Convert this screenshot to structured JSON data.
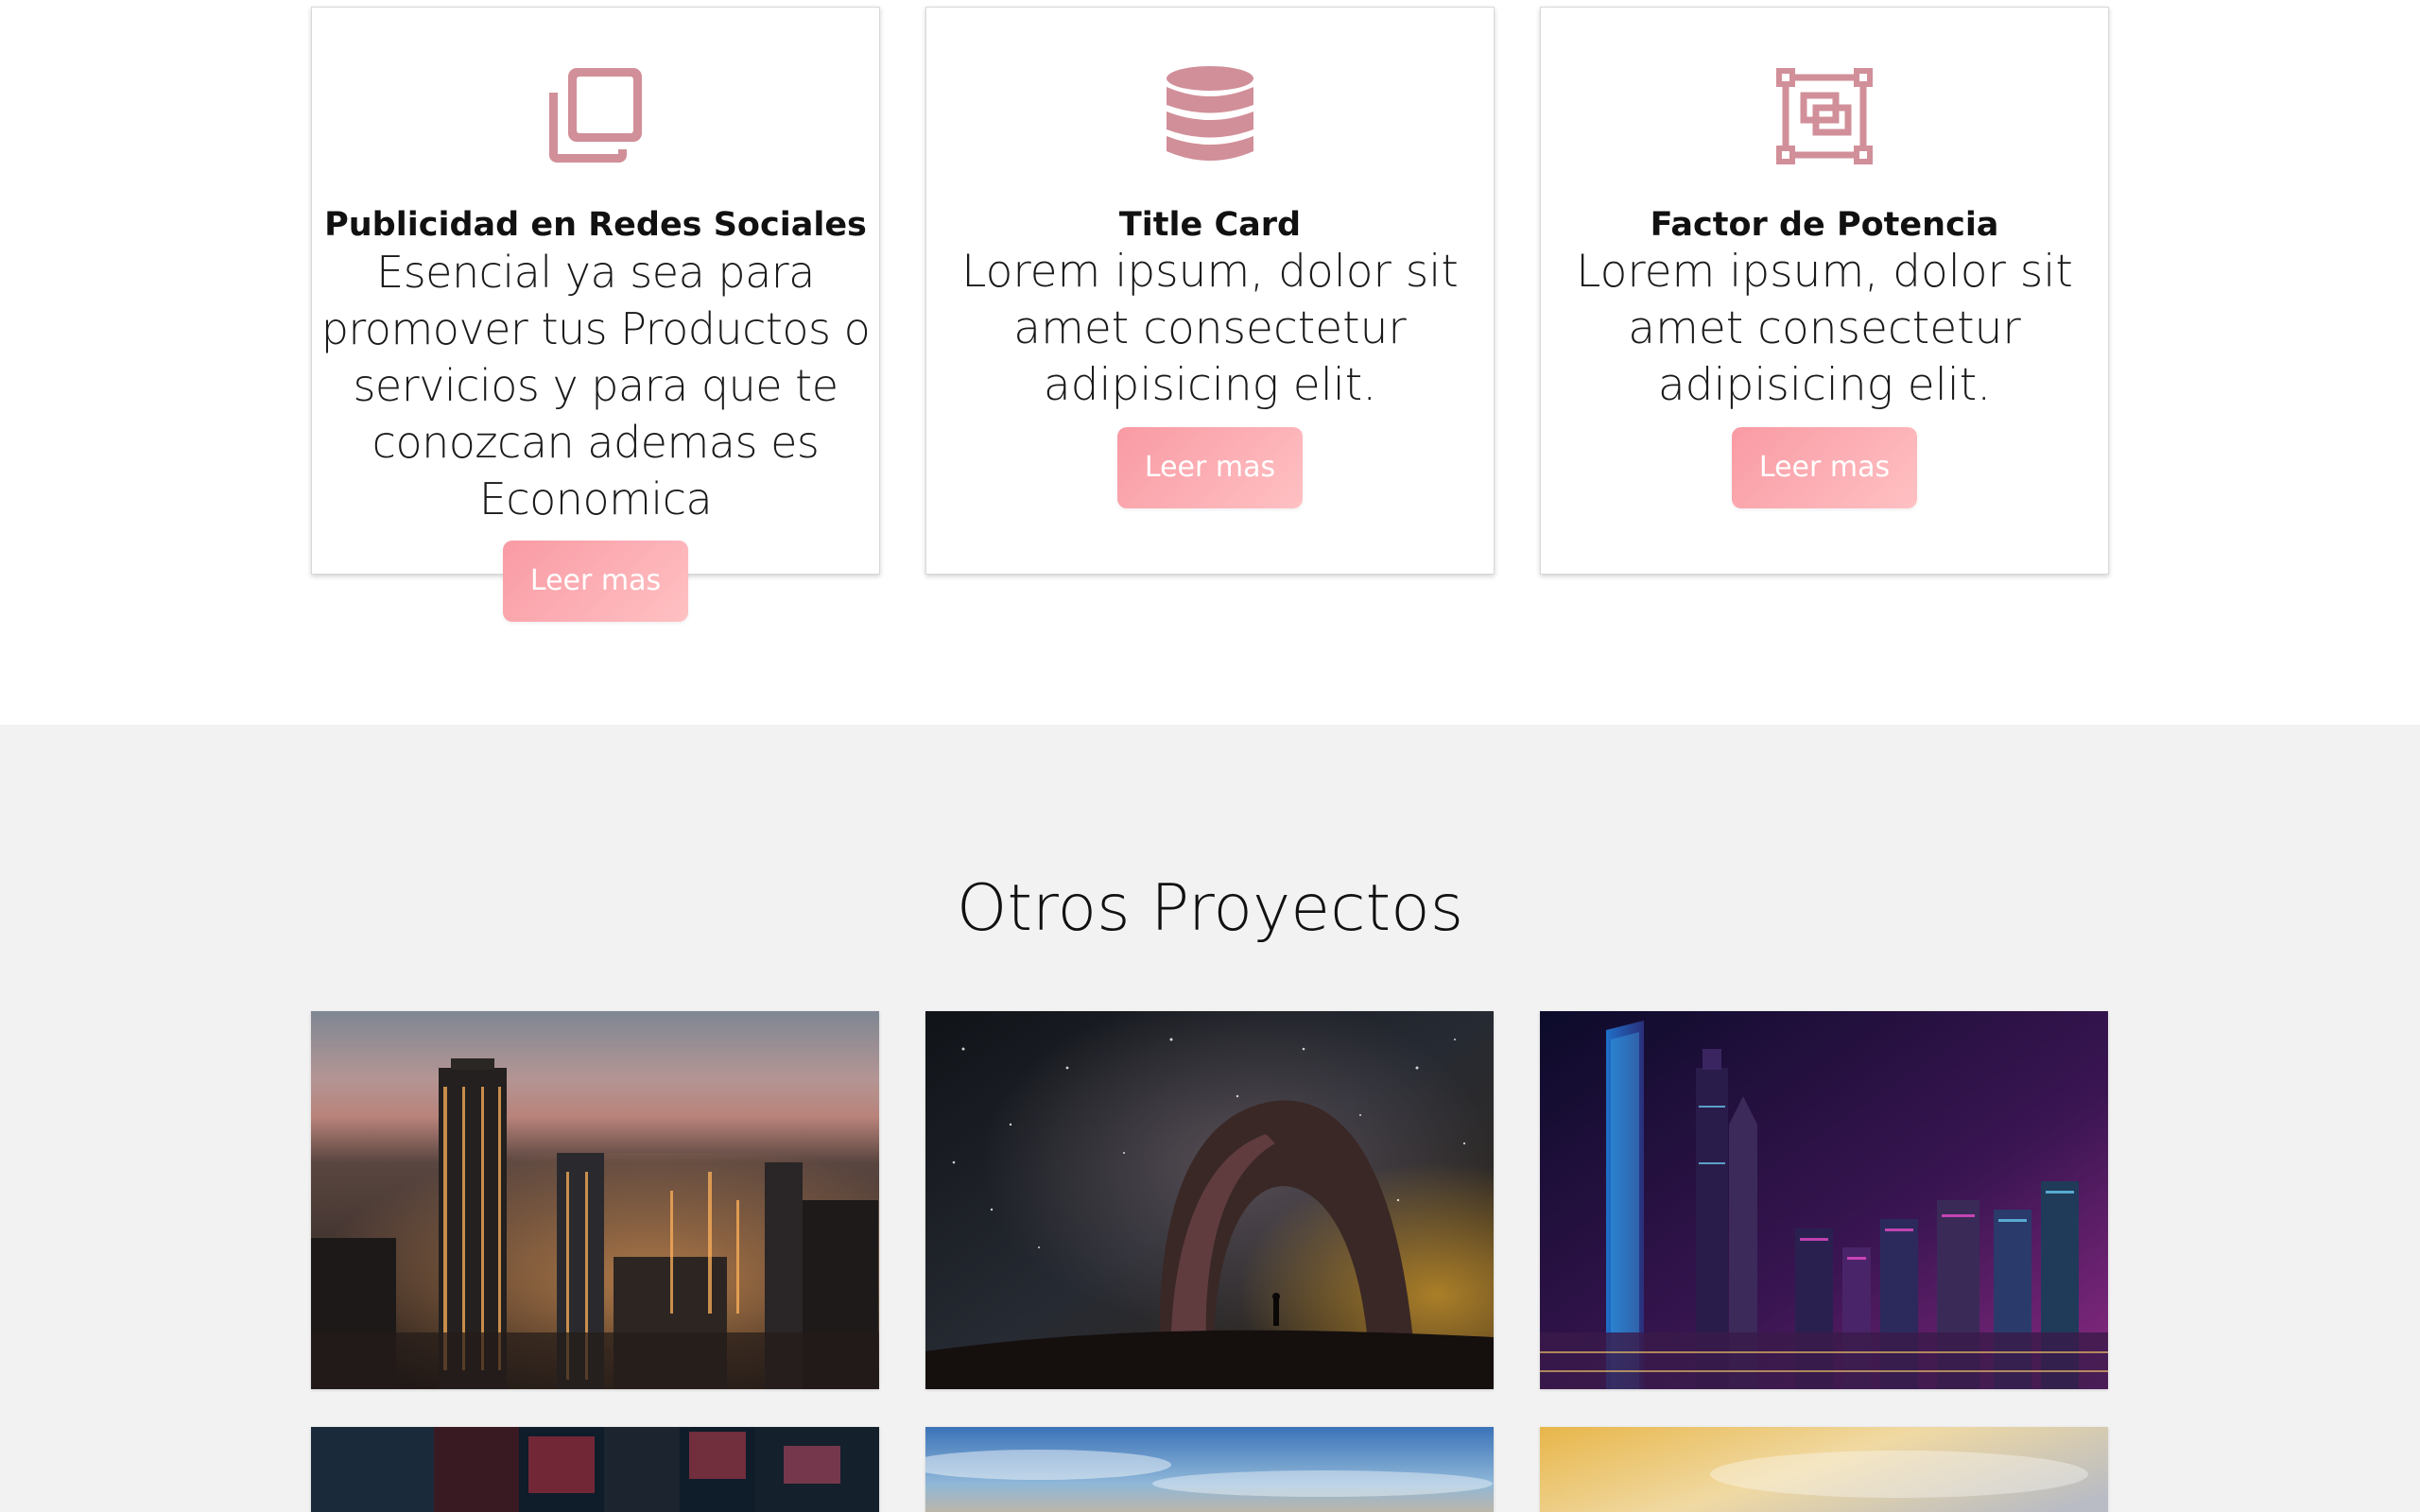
{
  "colors": {
    "icon": "#d18f99",
    "button_gradient_start": "#f99aa4",
    "button_gradient_end": "#ffc1c3",
    "section_bg": "#f2f2f2"
  },
  "services": {
    "cards": [
      {
        "icon": "copy-icon",
        "title": "Publicidad en Redes Sociales",
        "text": "Esencial ya sea para promover tus Productos o servicios y para que te conozcan ademas es Economica",
        "button": "Leer mas"
      },
      {
        "icon": "database-icon",
        "title": "Title Card",
        "text": "Lorem ipsum, dolor sit amet consectetur adipisicing elit.",
        "button": "Leer mas"
      },
      {
        "icon": "object-group-icon",
        "title": "Factor de Potencia",
        "text": "Lorem ipsum, dolor sit amet consectetur adipisicing elit.",
        "button": "Leer mas"
      }
    ]
  },
  "projects": {
    "title": "Otros Proyectos",
    "images": [
      "city-night-skyline-image",
      "starry-sky-arch-image",
      "neon-skyscrapers-image",
      "neon-street-image",
      "sunset-sky-image",
      "golden-sky-image"
    ]
  }
}
